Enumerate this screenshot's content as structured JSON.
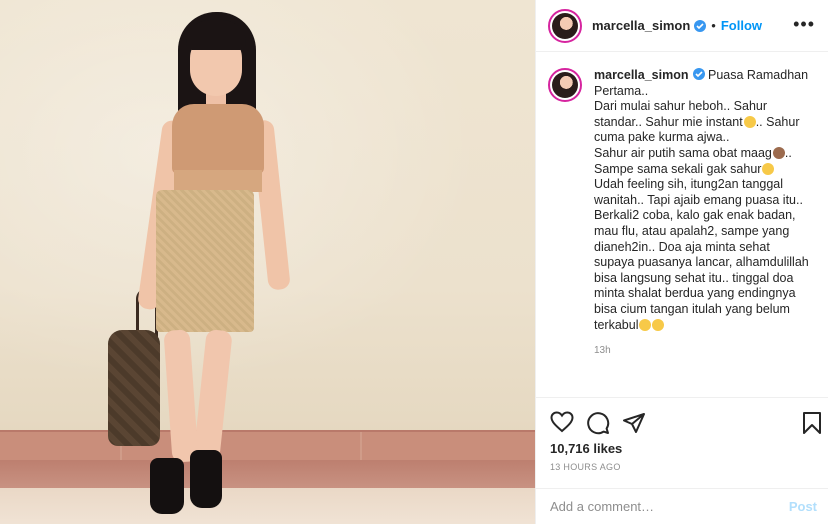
{
  "post": {
    "username": "marcella_simon",
    "follow_label": "Follow",
    "dot": "•",
    "more_label": "•••",
    "caption_first": "Puasa Ramadhan",
    "caption_lines": [
      "Pertama..",
      "Dari mulai sahur heboh.. Sahur",
      "standar.. Sahur mie instant",
      "cuma pake kurma ajwa..",
      "Sahur air putih sama obat maag",
      "Sampe sama sekali gak sahur",
      "Udah feeling sih, itung2an tanggal",
      "wanitah.. Tapi ajaib emang puasa itu..",
      "Berkali2 coba, kalo gak enak badan,",
      "mau flu, atau apalah2, sampe yang",
      "dianeh2in.. Doa aja minta sehat",
      "supaya puasanya lancar, alhamdulillah",
      "bisa langsung sehat itu.. tinggal doa",
      "minta shalat berdua yang endingnya",
      "bisa cium tangan itulah yang belum",
      "terkabul"
    ],
    "line3_suffix": ".. Sahur",
    "line5_suffix": "..",
    "time_ago": "13h",
    "likes": "10,716 likes",
    "date": "13 HOURS AGO",
    "comment_placeholder": "Add a comment…",
    "post_label": "Post"
  },
  "colors": {
    "accent": "#0095f6",
    "verified": "#3897f0",
    "post_disabled": "#b2dffc",
    "muted": "#8e8e8e"
  },
  "icons": [
    "heart-icon",
    "comment-icon",
    "share-icon",
    "bookmark-icon",
    "verified-badge-icon",
    "more-options-icon"
  ]
}
